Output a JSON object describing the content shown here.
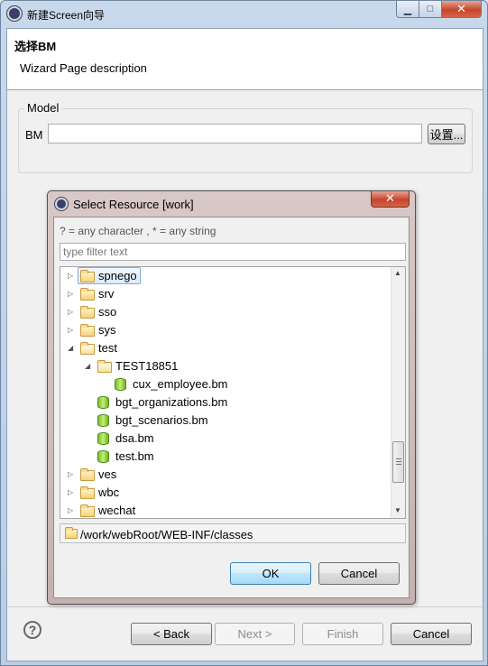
{
  "window": {
    "title": "新建Screen向导",
    "min_glyph": "▁",
    "max_glyph": "□",
    "close_glyph": "✕"
  },
  "header": {
    "title": "选择BM",
    "description": "Wizard Page description"
  },
  "model_group": {
    "label": "Model",
    "bm_label": "BM",
    "bm_value": "",
    "settings_button": "设置..."
  },
  "dialog": {
    "title": "Select Resource [work]",
    "close_glyph": "✕",
    "hint": "? = any character , * = any string",
    "filter_placeholder": "type filter text",
    "tree": [
      {
        "label": "spnego",
        "type": "folder",
        "depth": 0,
        "expanded": false,
        "selected": true
      },
      {
        "label": "srv",
        "type": "folder",
        "depth": 0,
        "expanded": false
      },
      {
        "label": "sso",
        "type": "folder",
        "depth": 0,
        "expanded": false
      },
      {
        "label": "sys",
        "type": "folder",
        "depth": 0,
        "expanded": false
      },
      {
        "label": "test",
        "type": "folder",
        "depth": 0,
        "expanded": true
      },
      {
        "label": "TEST18851",
        "type": "folder",
        "depth": 1,
        "expanded": true
      },
      {
        "label": "cux_employee.bm",
        "type": "bm",
        "depth": 2
      },
      {
        "label": "bgt_organizations.bm",
        "type": "bm",
        "depth": 1
      },
      {
        "label": "bgt_scenarios.bm",
        "type": "bm",
        "depth": 1
      },
      {
        "label": "dsa.bm",
        "type": "bm",
        "depth": 1
      },
      {
        "label": "test.bm",
        "type": "bm",
        "depth": 1
      },
      {
        "label": "ves",
        "type": "folder",
        "depth": 0,
        "expanded": false
      },
      {
        "label": "wbc",
        "type": "folder",
        "depth": 0,
        "expanded": false
      },
      {
        "label": "wechat",
        "type": "folder",
        "depth": 0,
        "expanded": false
      }
    ],
    "path": "/work/webRoot/WEB-INF/classes",
    "ok_label": "OK",
    "cancel_label": "Cancel"
  },
  "footer": {
    "help_glyph": "?",
    "back_label": "< Back",
    "next_label": "Next >",
    "finish_label": "Finish",
    "cancel_label": "Cancel"
  }
}
